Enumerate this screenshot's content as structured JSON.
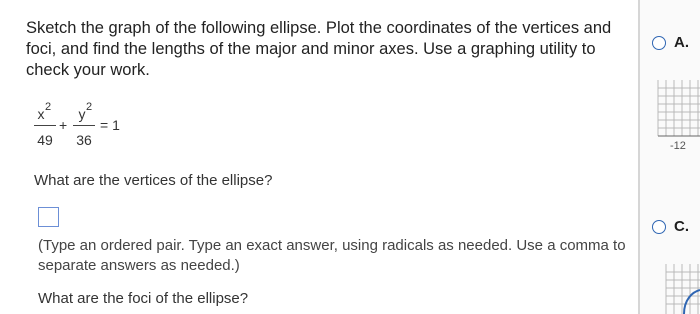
{
  "question": {
    "text": "Sketch the graph of the following ellipse. Plot the coordinates of the vertices and foci, and find the lengths of the major and minor axes. Use a graphing utility to check your work."
  },
  "equation": {
    "x_num": "x",
    "y_num": "y",
    "exp": "2",
    "x_den": "49",
    "y_den": "36",
    "plus": "+",
    "equals": "= 1"
  },
  "part1": {
    "prompt": "What are the vertices of the ellipse?",
    "hint": "(Type an ordered pair. Type an exact answer, using radicals as needed. Use a comma to separate answers as needed.)"
  },
  "part2": {
    "prompt": "What are the foci of the ellipse?"
  },
  "options": {
    "a_label": "A.",
    "c_label": "C.",
    "a_tick": "-12"
  },
  "colors": {
    "radio": "#2f66b3",
    "input_border": "#6c8fd6",
    "divider": "#d6d6d6"
  }
}
